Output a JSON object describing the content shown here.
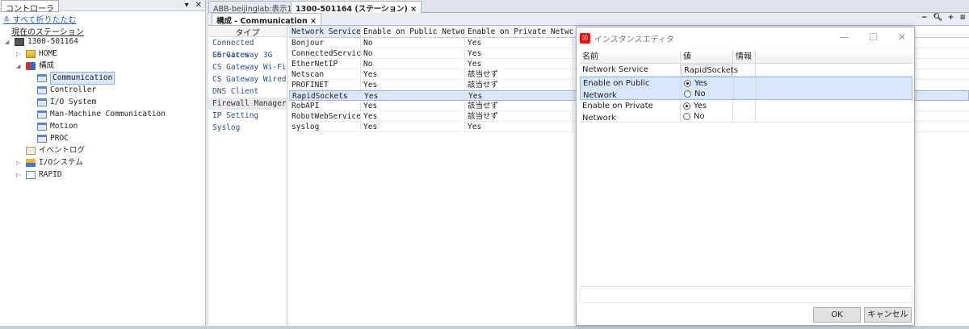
{
  "left_panel": {
    "tab": "コントローラ",
    "collapse_all": "すべて折りたたむ",
    "current_station": "現在のステーション",
    "tree": [
      {
        "label": "1300-501164",
        "icon": "controller-icon",
        "level": 0,
        "expander": "expanded"
      },
      {
        "label": "HOME",
        "icon": "folder-icon",
        "level": 1,
        "expander": "collapsed"
      },
      {
        "label": "構成",
        "icon": "config-icon",
        "level": 1,
        "expander": "expanded"
      },
      {
        "label": "Communication",
        "icon": "grid-icon",
        "level": 2,
        "selected": true
      },
      {
        "label": "Controller",
        "icon": "grid-icon",
        "level": 2
      },
      {
        "label": "I/O System",
        "icon": "grid-icon",
        "level": 2
      },
      {
        "label": "Man-Machine Communication",
        "icon": "grid-icon",
        "level": 2
      },
      {
        "label": "Motion",
        "icon": "grid-icon",
        "level": 2
      },
      {
        "label": "PROC",
        "icon": "grid-icon",
        "level": 2
      },
      {
        "label": "イベントログ",
        "icon": "log-icon",
        "level": 1
      },
      {
        "label": "I/Oシステム",
        "icon": "io-icon",
        "level": 1,
        "expander": "collapsed"
      },
      {
        "label": "RAPID",
        "icon": "rapid-icon",
        "level": 1,
        "expander": "collapsed"
      }
    ]
  },
  "doc_tabs": [
    "ABB-beijinglab:表示1",
    "1300-501164 (ステーション)"
  ],
  "sub_tab": "構成 - Communication",
  "types": {
    "header": "タイプ",
    "items": [
      "Connected Services",
      "CS Gateway 3G",
      "CS Gateway Wi-Fi",
      "CS Gateway Wired",
      "DNS Client",
      "Firewall Manager",
      "IP Setting",
      "Syslog"
    ],
    "selected": "Firewall Manager"
  },
  "grid": {
    "columns": [
      "Network Service",
      "Enable on Public Network",
      "Enable on Private Network"
    ],
    "rows": [
      [
        "Bonjour",
        "No",
        "Yes"
      ],
      [
        "ConnectedServices",
        "No",
        "Yes"
      ],
      [
        "EtherNetIP",
        "No",
        "Yes"
      ],
      [
        "Netscan",
        "Yes",
        "該当せず"
      ],
      [
        "PROFINET",
        "Yes",
        "該当せず"
      ],
      [
        "RapidSockets",
        "Yes",
        "Yes"
      ],
      [
        "RobAPI",
        "Yes",
        "該当せず"
      ],
      [
        "RobotWebServices",
        "Yes",
        "該当せず"
      ],
      [
        "syslog",
        "Yes",
        "Yes"
      ]
    ],
    "selected_row": 5
  },
  "dialog": {
    "title": "インスタンスエディタ",
    "headers": [
      "名前",
      "値",
      "情報"
    ],
    "rows": [
      {
        "name": "Network Service",
        "value": "RapidSockets"
      },
      {
        "name": "Enable on Public Network",
        "options": [
          "Yes",
          "No"
        ],
        "selected": "Yes"
      },
      {
        "name": "Enable on Private Network",
        "options": [
          "Yes",
          "No"
        ],
        "selected": "Yes"
      }
    ],
    "ok": "OK",
    "cancel": "キャンセル"
  },
  "colors": {
    "accent": "#1a5fb4",
    "selection": "#dbe6f8"
  }
}
